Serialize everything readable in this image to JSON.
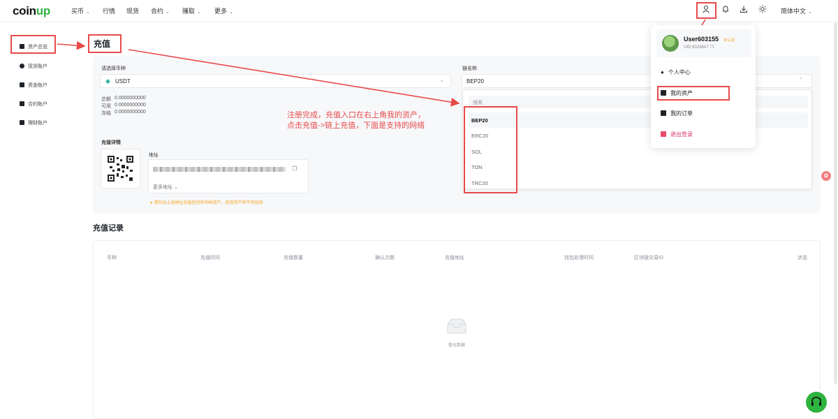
{
  "nav": {
    "logo_main": "coin",
    "logo_accent": "up",
    "items": [
      "买币",
      "行情",
      "现货",
      "合约",
      "赚取",
      "更多"
    ],
    "language": "简体中文"
  },
  "sidebar": {
    "items": [
      "资产总览",
      "现货账户",
      "资金账户",
      "合约账户",
      "理财账户"
    ]
  },
  "page_title": "充值",
  "deposit": {
    "coin_label": "请选择币种",
    "coin_value": "USDT",
    "chain_label": "链名称",
    "chain_value": "BEP20",
    "balances": [
      {
        "label": "总额",
        "value": "0.0000000000"
      },
      {
        "label": "可用",
        "value": "0.0000000000"
      },
      {
        "label": "冻结",
        "value": "0.0000000000"
      }
    ],
    "details_title": "充值详情",
    "address_label": "地址",
    "more_address": "更多地址",
    "warning": "请勿向上述地址充值任何非币种资产，否则资产将不可找回",
    "search_placeholder": "搜索",
    "networks": [
      "BEP20",
      "ERC20",
      "SOL",
      "TON",
      "TRC20"
    ]
  },
  "annotation": {
    "line1": "注册完成，充值入口在右上角我的资产，",
    "line2": "点击充值->链上充值，下面是支持的网络"
  },
  "user_menu": {
    "username": "User603155",
    "verify_badge": "未认证",
    "uid": "UID 60248A7",
    "items": [
      "个人中心",
      "我的资产",
      "我的订单",
      "退出登录"
    ]
  },
  "records": {
    "title": "充值记录",
    "columns": [
      "币种",
      "充值时间",
      "充值数量",
      "确认次数",
      "充值地址",
      "钱包处理时间",
      "区块链交易ID",
      "状态"
    ],
    "empty_text": "暂无数据"
  },
  "colors": {
    "accent_green": "#2fb33f",
    "annotation_red": "#e84a4a",
    "warning_orange": "#f5a623"
  }
}
